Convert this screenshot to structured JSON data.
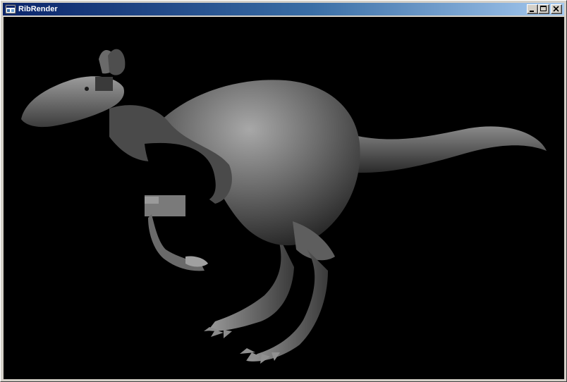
{
  "window": {
    "title": "RibRender",
    "icon": "app-window-icon",
    "controls": {
      "minimize_icon": "minimize-icon",
      "maximize_icon": "maximize-icon",
      "close_icon": "close-icon"
    }
  },
  "render": {
    "background_color": "#000000",
    "subject": "kangaroo-3d-model"
  },
  "colors": {
    "titlebar_start": "#0a246a",
    "titlebar_end": "#a6caf0",
    "frame": "#d4d0c8"
  }
}
